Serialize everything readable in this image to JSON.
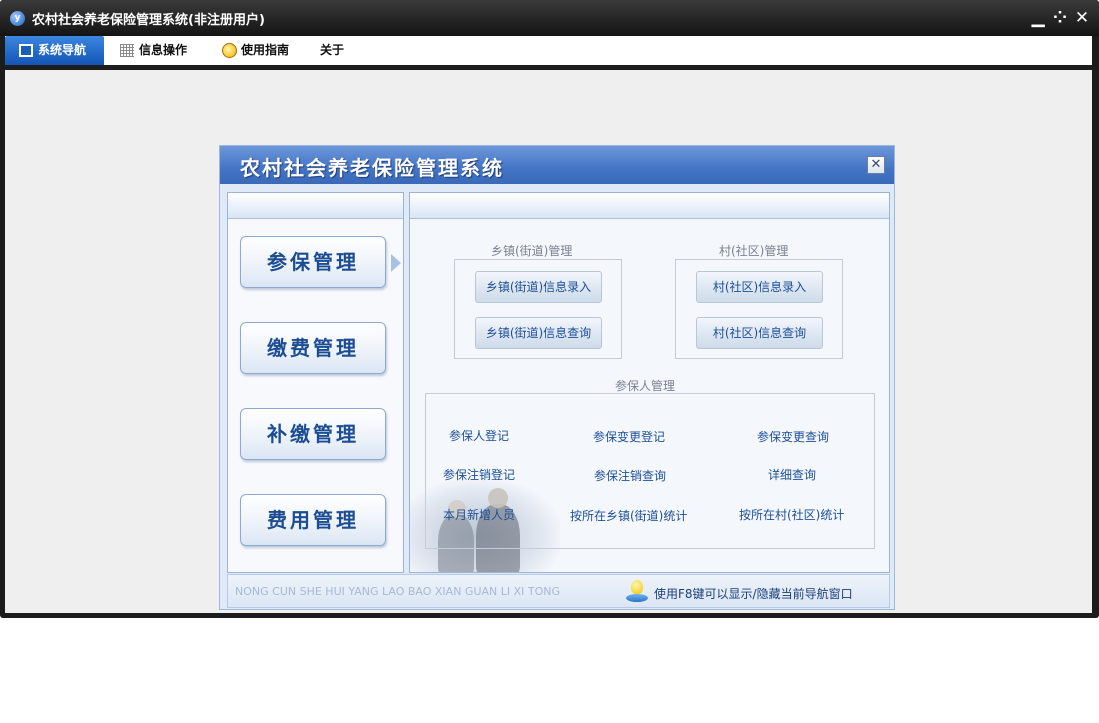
{
  "window": {
    "title": "农村社会养老保险管理系统(非注册用户)",
    "app_icon_glyph": "y",
    "controls": {
      "minimize": "▁",
      "maximize": "⁘",
      "close": "✕"
    }
  },
  "menubar": {
    "tabs": [
      {
        "label": "系统导航",
        "icon": "monitor-icon",
        "active": true
      },
      {
        "label": "信息操作",
        "icon": "grid-icon",
        "active": false
      },
      {
        "label": "使用指南",
        "icon": "help-icon",
        "active": false
      },
      {
        "label": "关于",
        "active": false
      }
    ]
  },
  "dialog": {
    "title": "农村社会养老保险管理系统",
    "close_glyph": "✕",
    "nav": [
      {
        "label": "参保管理",
        "selected": true
      },
      {
        "label": "缴费管理"
      },
      {
        "label": "补缴管理"
      },
      {
        "label": "费用管理"
      }
    ],
    "town_group": {
      "title": "乡镇(街道)管理",
      "buttons": [
        "乡镇(街道)信息录入",
        "乡镇(街道)信息查询"
      ]
    },
    "village_group": {
      "title": "村(社区)管理",
      "buttons": [
        "村(社区)信息录入",
        "村(社区)信息查询"
      ]
    },
    "insured_group": {
      "title": "参保人管理",
      "links": [
        "参保人登记",
        "参保变更登记",
        "参保变更查询",
        "参保注销登记",
        "参保注销查询",
        "详细查询",
        "本月新增人员",
        "按所在乡镇(街道)统计",
        "按所在村(社区)统计"
      ]
    },
    "status": {
      "pinyin": "NONG CUN SHE HUI YANG LAO BAO XIAN GUAN LI XI TONG",
      "hint": "使用F8键可以显示/隐藏当前导航窗口"
    }
  },
  "colors": {
    "accent": "#1455b6",
    "dialog_title": "#4374c5",
    "link_text": "#1d4f98",
    "titlebar": "#1c1c1c"
  }
}
